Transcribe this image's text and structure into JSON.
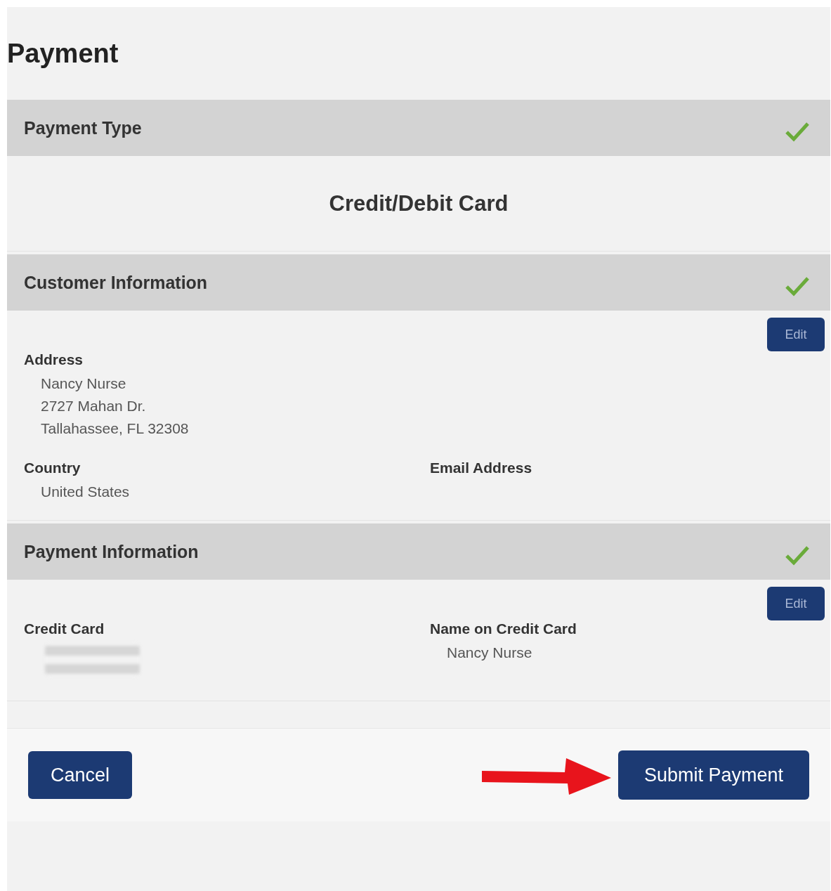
{
  "page_title": "Payment",
  "sections": [
    {
      "title": "Payment Type",
      "complete": true,
      "kind": "type",
      "value": "Credit/Debit Card"
    },
    {
      "title": "Customer Information",
      "complete": true,
      "kind": "fields",
      "edit": "Edit",
      "fields": [
        {
          "label": "Address",
          "lines": [
            "Nancy Nurse",
            "2727 Mahan Dr.",
            "Tallahassee, FL 32308"
          ],
          "wide": true
        },
        {
          "label": "Country",
          "lines": [
            "United States"
          ]
        },
        {
          "label": "Email Address"
        }
      ]
    },
    {
      "title": "Payment Information",
      "complete": true,
      "kind": "fields",
      "edit": "Edit",
      "fields": [
        {
          "label": "Credit Card",
          "redacted": true
        },
        {
          "label": "Name on Credit Card",
          "lines": [
            "Nancy Nurse"
          ]
        }
      ]
    }
  ],
  "buttons": [
    {
      "label": "Cancel",
      "kind": "secondary"
    },
    {
      "label": "Submit Payment",
      "kind": "primary",
      "arrow": true
    }
  ]
}
